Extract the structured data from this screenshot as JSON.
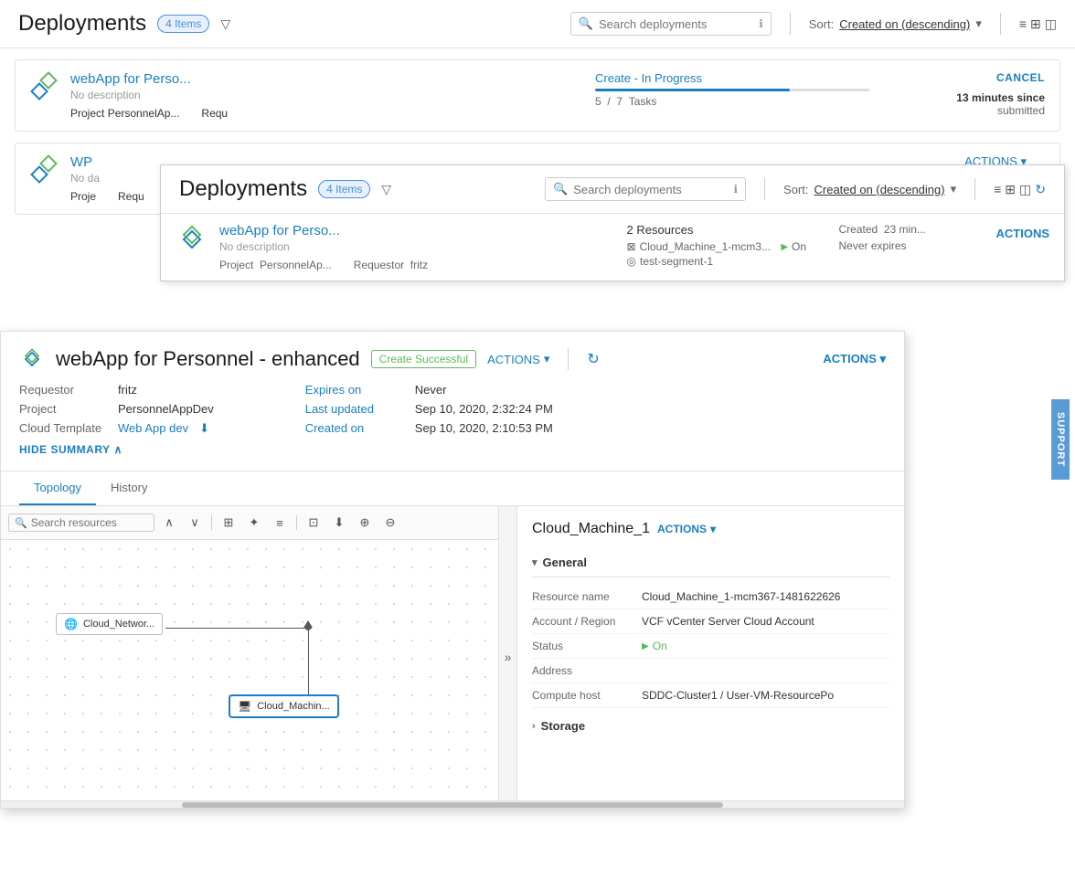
{
  "page": {
    "title": "Deployments",
    "bg_items_count": "4 Items",
    "bg_search_placeholder": "Search deployments",
    "bg_sort_label": "Sort:",
    "bg_sort_value": "Created on (descending)",
    "bg_card1": {
      "title": "webApp for Perso...",
      "description": "No description",
      "project_label": "Project",
      "project_value": "PersonnelAp...",
      "requestor_label": "Requ",
      "status": "Create - In Progress",
      "tasks_current": "5",
      "tasks_total": "7",
      "tasks_label": "Tasks",
      "cancel_label": "CANCEL",
      "submitted": "13 minutes since",
      "submitted2": "submitted"
    },
    "bg_card2": {
      "title": "WP",
      "description": "No da",
      "project_label": "Proje",
      "requestor_label": "Requ"
    }
  },
  "overlay": {
    "title": "Deployments",
    "items_count": "4 Items",
    "search_placeholder": "Search deployments",
    "sort_label": "Sort:",
    "sort_value": "Created on (descending)",
    "card": {
      "title": "webApp for Perso...",
      "description": "No description",
      "project_label": "Project",
      "project_value": "PersonnelAp...",
      "requestor_label": "Requestor",
      "requestor_value": "fritz",
      "resources_count": "2 Resources",
      "resource1": "Cloud_Machine_1-mcm3...",
      "resource2": "test-segment-1",
      "status_label": "On",
      "created_label": "Created",
      "created_value": "23 min...",
      "expires_label": "Never expires",
      "actions_label": "ACTIONS"
    }
  },
  "detail": {
    "title": "webApp for Personnel - enhanced",
    "status_badge": "Create Successful",
    "actions_label": "ACTIONS",
    "requestor_label": "Requestor",
    "requestor_value": "fritz",
    "project_label": "Project",
    "project_value": "PersonnelAppDev",
    "template_label": "Cloud Template",
    "template_value": "Web App dev",
    "expires_label": "Expires on",
    "expires_value": "Never",
    "last_updated_label": "Last updated",
    "last_updated_value": "Sep 10, 2020, 2:32:24 PM",
    "created_label": "Created on",
    "created_value": "Sep 10, 2020, 2:10:53 PM",
    "hide_summary": "HIDE SUMMARY",
    "tabs": [
      "Topology",
      "History"
    ],
    "active_tab": "Topology",
    "search_resources_placeholder": "Search resources",
    "right_panel_title": "Cloud_Machine_1",
    "right_panel_actions": "ACTIONS",
    "general_section": "General",
    "properties": [
      {
        "key": "Resource name",
        "value": "Cloud_Machine_1-mcm367-1481622626",
        "type": "normal"
      },
      {
        "key": "Account / Region",
        "value": "VCF vCenter Server Cloud Account",
        "type": "normal"
      },
      {
        "key": "Status",
        "value": "On",
        "type": "green"
      },
      {
        "key": "Address",
        "value": "",
        "type": "normal"
      },
      {
        "key": "Compute host",
        "value": "SDDC-Cluster1 / User-VM-ResourcePo",
        "type": "normal"
      }
    ],
    "storage_section": "Storage"
  }
}
